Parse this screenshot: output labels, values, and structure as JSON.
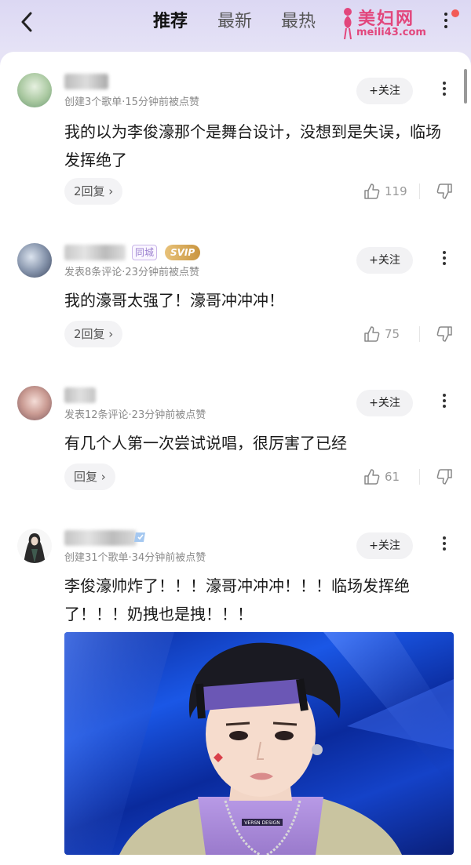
{
  "header": {
    "tabs": [
      {
        "label": "推荐",
        "active": true
      },
      {
        "label": "最新",
        "active": false
      },
      {
        "label": "最热",
        "active": false
      }
    ],
    "watermark": {
      "text": "美妇网",
      "url": "meili43.com"
    },
    "icons": {
      "back": "chevron-left-icon",
      "more": "vertical-dots-icon",
      "notification": "red-dot"
    }
  },
  "comments": [
    {
      "meta": "创建3个歌单·15分钟前被点赞",
      "follow_label": "+关注",
      "text": "我的以为李俊濠那个是舞台设计，没想到是失误，临场发挥绝了",
      "reply_label": "2回复 ›",
      "likes": "119"
    },
    {
      "badges": {
        "city": "同城",
        "vip": "SVIP"
      },
      "meta": "发表8条评论·23分钟前被点赞",
      "follow_label": "+关注",
      "text": "我的濠哥太强了！濠哥冲冲冲！",
      "reply_label": "2回复 ›",
      "likes": "75"
    },
    {
      "meta": "发表12条评论·23分钟前被点赞",
      "follow_label": "+关注",
      "text": "有几个人第一次尝试说唱，很厉害了已经",
      "reply_label": "回复 ›",
      "likes": "61"
    },
    {
      "meta": "创建31个歌单·34分钟前被点赞",
      "follow_label": "+关注",
      "text": "李俊濠帅炸了！！！濠哥冲冲冲！！！临场发挥绝了！！！奶拽也是拽！！！",
      "photo_shirt_text": "VERSN DESIGN"
    }
  ],
  "colors": {
    "accent_red": "#f25a56",
    "watermark_pink": "#e2467c",
    "meta_gray": "#8a8a8a",
    "header_bg": "#dcd8f3"
  }
}
